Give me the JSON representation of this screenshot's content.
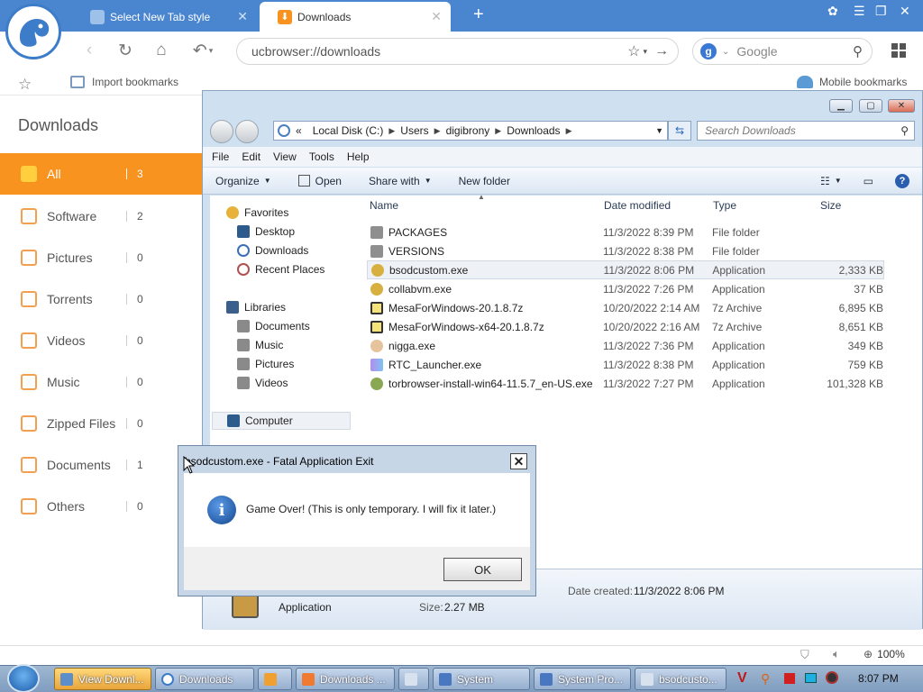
{
  "browser": {
    "tabs": [
      {
        "label": "Select New Tab style"
      },
      {
        "label": "Downloads"
      }
    ],
    "new_tab": "+",
    "address": "ucbrowser://downloads",
    "search_placeholder": "Google",
    "bookmarks": {
      "import": "Import bookmarks",
      "mobile": "Mobile bookmarks"
    },
    "zoom": "100%"
  },
  "sidebar": {
    "title": "Downloads",
    "items": [
      {
        "label": "All",
        "count": "3"
      },
      {
        "label": "Software",
        "count": "2"
      },
      {
        "label": "Pictures",
        "count": "0"
      },
      {
        "label": "Torrents",
        "count": "0"
      },
      {
        "label": "Videos",
        "count": "0"
      },
      {
        "label": "Music",
        "count": "0"
      },
      {
        "label": "Zipped Files",
        "count": "0"
      },
      {
        "label": "Documents",
        "count": "1"
      },
      {
        "label": "Others",
        "count": "0"
      }
    ]
  },
  "explorer": {
    "path": [
      "«",
      "Local Disk (C:)",
      "Users",
      "digibrony",
      "Downloads"
    ],
    "search_placeholder": "Search Downloads",
    "menu": [
      "File",
      "Edit",
      "View",
      "Tools",
      "Help"
    ],
    "toolbar": {
      "organize": "Organize",
      "open": "Open",
      "share": "Share with",
      "new_folder": "New folder"
    },
    "nav": {
      "favorites": "Favorites",
      "desktop": "Desktop",
      "downloads": "Downloads",
      "recent": "Recent Places",
      "libraries": "Libraries",
      "documents": "Documents",
      "music": "Music",
      "pictures": "Pictures",
      "videos": "Videos",
      "computer": "Computer"
    },
    "columns": {
      "name": "Name",
      "date": "Date modified",
      "type": "Type",
      "size": "Size"
    },
    "files": [
      {
        "name": "PACKAGES",
        "date": "11/3/2022 8:39 PM",
        "type": "File folder",
        "size": ""
      },
      {
        "name": "VERSIONS",
        "date": "11/3/2022 8:38 PM",
        "type": "File folder",
        "size": ""
      },
      {
        "name": "bsodcustom.exe",
        "date": "11/3/2022 8:06 PM",
        "type": "Application",
        "size": "2,333 KB"
      },
      {
        "name": "collabvm.exe",
        "date": "11/3/2022 7:26 PM",
        "type": "Application",
        "size": "37 KB"
      },
      {
        "name": "MesaForWindows-20.1.8.7z",
        "date": "10/20/2022 2:14 AM",
        "type": "7z Archive",
        "size": "6,895 KB"
      },
      {
        "name": "MesaForWindows-x64-20.1.8.7z",
        "date": "10/20/2022 2:16 AM",
        "type": "7z Archive",
        "size": "8,651 KB"
      },
      {
        "name": "nigga.exe",
        "date": "11/3/2022 7:36 PM",
        "type": "Application",
        "size": "349 KB"
      },
      {
        "name": "RTC_Launcher.exe",
        "date": "11/3/2022 8:38 PM",
        "type": "Application",
        "size": "759 KB"
      },
      {
        "name": "torbrowser-install-win64-11.5.7_en-US.exe",
        "date": "11/3/2022 7:27 PM",
        "type": "Application",
        "size": "101,328 KB"
      }
    ],
    "details": {
      "type": "Application",
      "date_label": "Date created:",
      "date_value": "11/3/2022 8:06 PM",
      "size_label": "Size:",
      "size_value": "2.27 MB"
    }
  },
  "dialog": {
    "title": "bsodcustom.exe - Fatal Application Exit",
    "message": "Game Over! (This is only temporary. I will fix it later.)",
    "ok": "OK",
    "info_glyph": "i"
  },
  "taskbar": {
    "items": [
      "View Downl...",
      "Downloads",
      "",
      "Downloads ...",
      "",
      "System",
      "System Pro...",
      "bsodcusto..."
    ],
    "clock": "8:07 PM"
  }
}
